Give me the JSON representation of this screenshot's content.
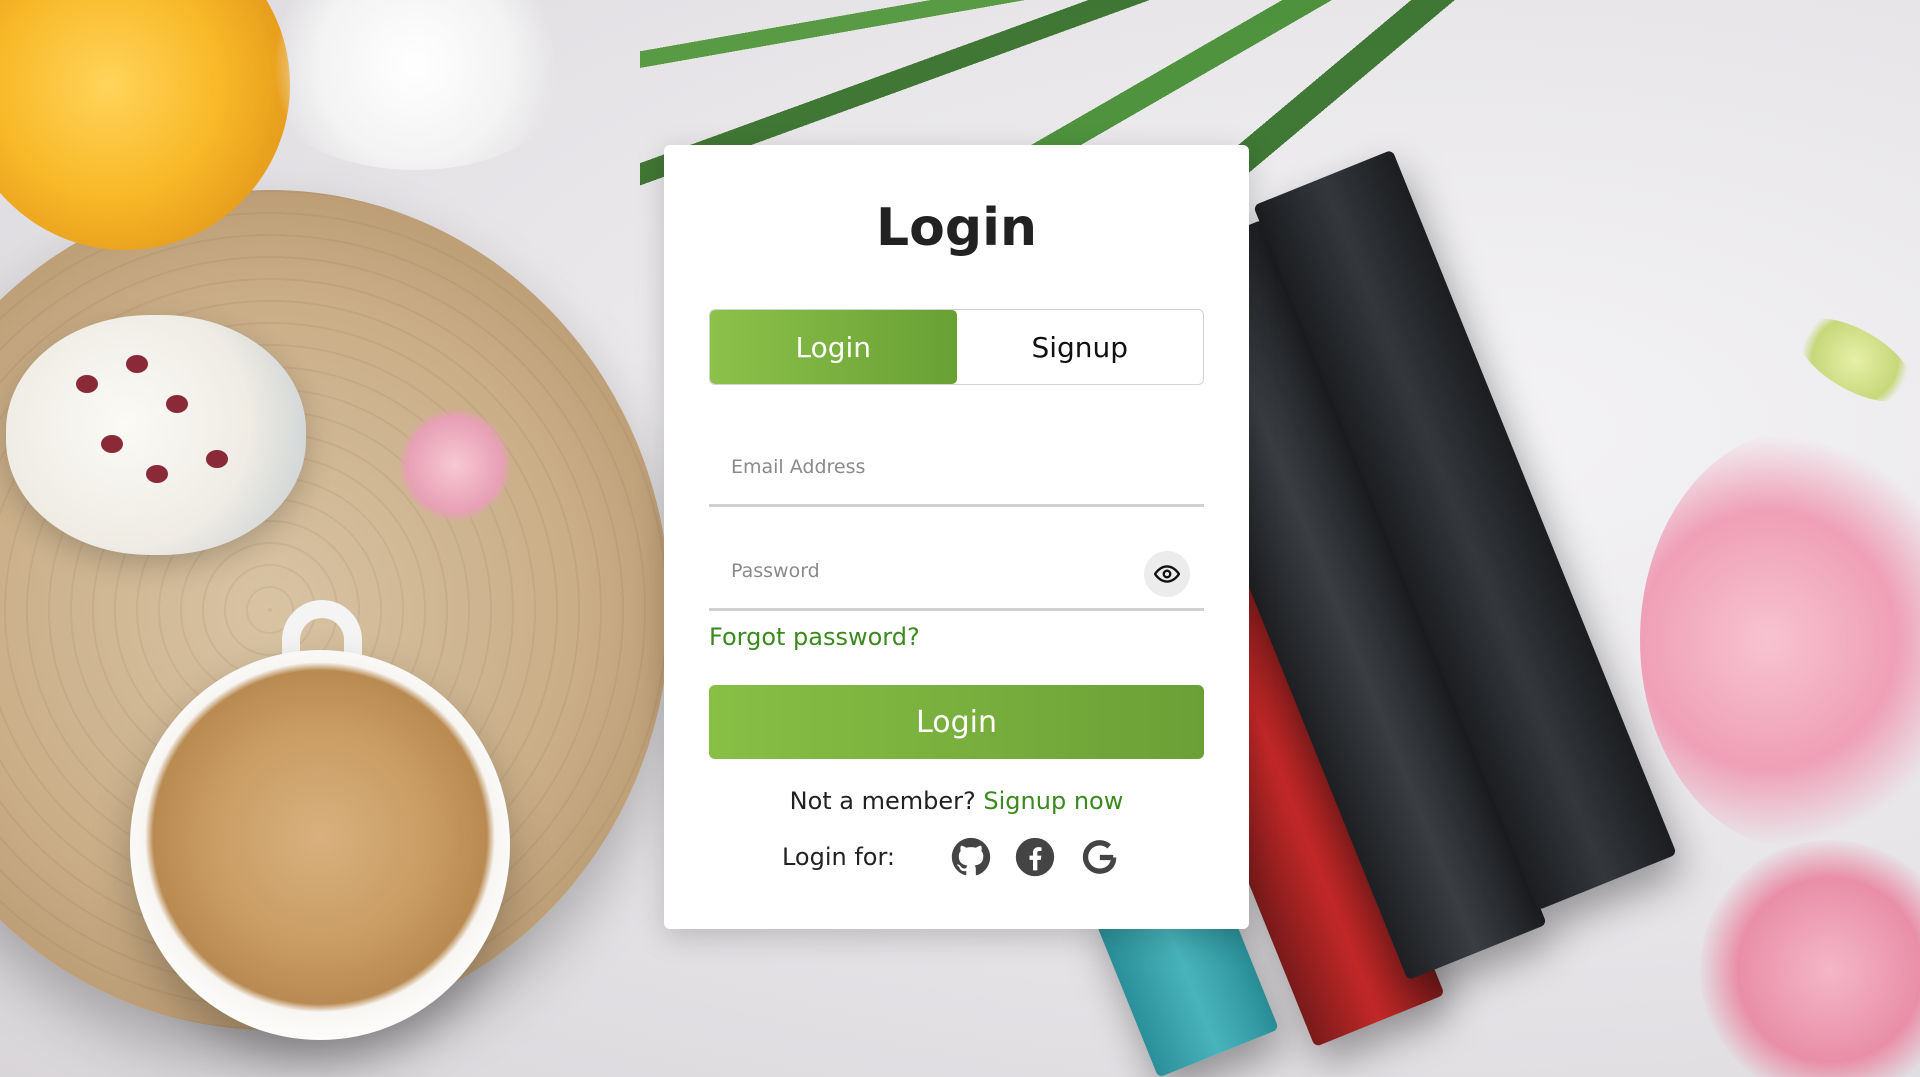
{
  "card": {
    "title": "Login"
  },
  "tabs": [
    {
      "label": "Login",
      "active": true
    },
    {
      "label": "Signup",
      "active": false
    }
  ],
  "form": {
    "email": {
      "value": "",
      "placeholder": "Email Address"
    },
    "password": {
      "value": "",
      "placeholder": "Password",
      "toggle_icon": "eye-icon"
    },
    "forgot_label": "Forgot password?",
    "submit_label": "Login"
  },
  "footer": {
    "not_member_text": "Not a member?",
    "signup_link": "Signup now",
    "login_for_label": "Login for:",
    "social_icons": [
      "github-icon",
      "facebook-icon",
      "google-icon"
    ]
  },
  "colors": {
    "accent_start": "#8cc14a",
    "accent_end": "#68a034",
    "link": "#3a8a1e"
  }
}
